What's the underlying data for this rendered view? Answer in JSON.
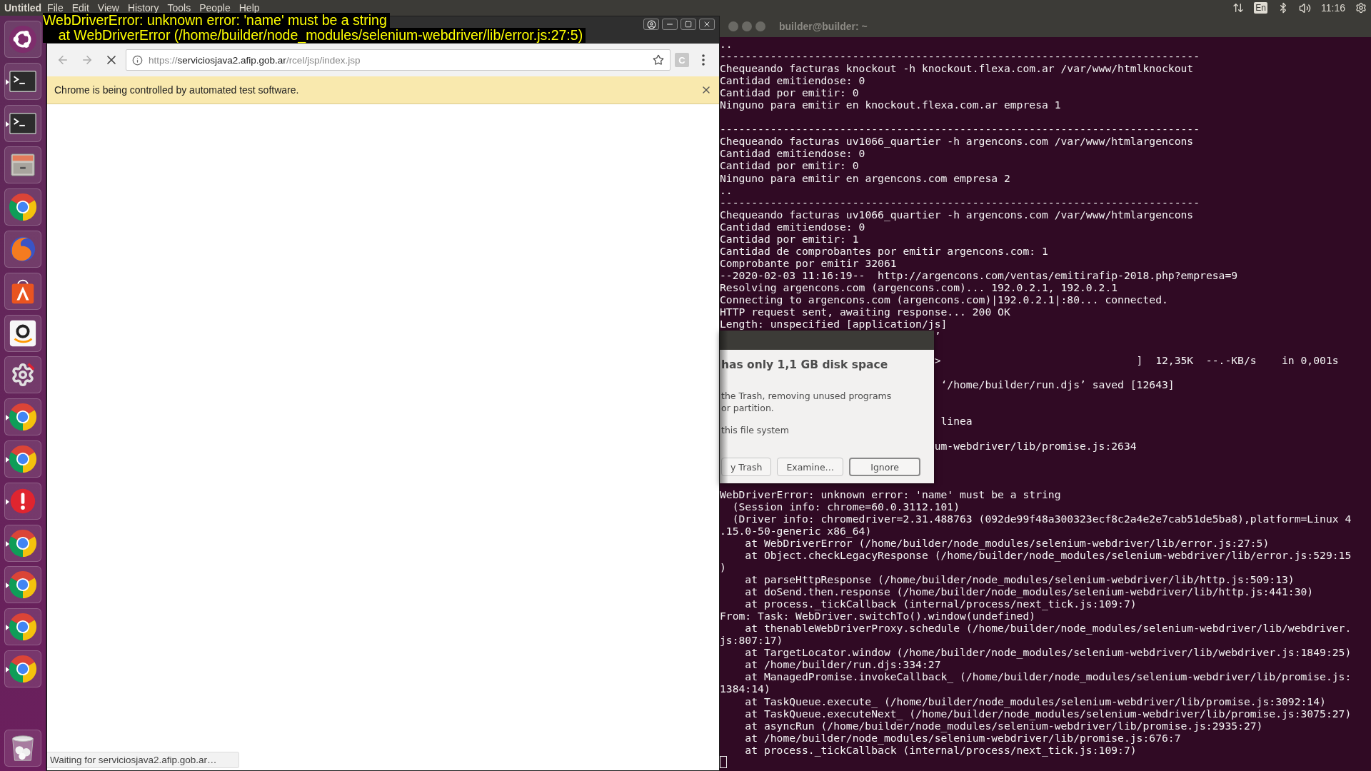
{
  "top_panel": {
    "app_title": "Untitled",
    "menu": [
      "File",
      "Edit",
      "View",
      "History",
      "Tools",
      "People",
      "Help"
    ],
    "keyboard_layout": "En",
    "clock": "11:16"
  },
  "error_overlay": {
    "lines": [
      "WebDriverError: unknown error: 'name' must be a string",
      "    at WebDriverError (/home/builder/node_modules/selenium-webdriver/lib/error.js:27:5)"
    ]
  },
  "launcher": [
    {
      "kind": "ubuntu",
      "running": false
    },
    {
      "kind": "terminal",
      "running": true
    },
    {
      "kind": "terminal",
      "running": true
    },
    {
      "kind": "files",
      "running": false
    },
    {
      "kind": "chrome",
      "running": false
    },
    {
      "kind": "firefox",
      "running": false
    },
    {
      "kind": "store",
      "running": false
    },
    {
      "kind": "amazon",
      "running": false
    },
    {
      "kind": "settings",
      "running": false
    },
    {
      "kind": "chrome",
      "running": true
    },
    {
      "kind": "chrome",
      "running": true
    },
    {
      "kind": "update",
      "running": true
    },
    {
      "kind": "chrome",
      "running": true
    },
    {
      "kind": "chrome",
      "running": true
    },
    {
      "kind": "chrome",
      "running": true
    },
    {
      "kind": "chrome",
      "running": true
    },
    {
      "kind": "trash",
      "running": false
    }
  ],
  "browser": {
    "url": {
      "scheme": "https://",
      "host": "serviciosjava2.afip.gob.ar",
      "path": "/rcel/jsp/index.jsp"
    },
    "loading": true,
    "extension_label": "C",
    "infobar": "Chrome is being controlled by automated test software.",
    "status": "Waiting for serviciosjava2.afip.gob.ar…"
  },
  "terminal": {
    "title": "builder@builder: ~",
    "lines": [
      {
        "kind": "text",
        "text": ".."
      },
      {
        "kind": "text",
        "text": "----------------------------------------------------------------------------"
      },
      {
        "kind": "text",
        "text": "Chequeando facturas knockout -h knockout.flexa.com.ar /var/www/htmlknockout"
      },
      {
        "kind": "text",
        "text": "Cantidad emitiendose: 0"
      },
      {
        "kind": "text",
        "text": "Cantidad por emitir: 0"
      },
      {
        "kind": "text",
        "text": "Ninguno para emitir en knockout.flexa.com.ar empresa 1"
      },
      {
        "kind": "blank"
      },
      {
        "kind": "text",
        "text": "----------------------------------------------------------------------------"
      },
      {
        "kind": "text",
        "text": "Chequeando facturas uv1066_quartier -h argencons.com /var/www/htmlargencons"
      },
      {
        "kind": "text",
        "text": "Cantidad emitiendose: 0"
      },
      {
        "kind": "text",
        "text": "Cantidad por emitir: 0"
      },
      {
        "kind": "text",
        "text": "Ninguno para emitir en argencons.com empresa 2"
      },
      {
        "kind": "text",
        "text": ".."
      },
      {
        "kind": "text",
        "text": "----------------------------------------------------------------------------"
      },
      {
        "kind": "text",
        "text": "Chequeando facturas uv1066_quartier -h argencons.com /var/www/htmlargencons"
      },
      {
        "kind": "text",
        "text": "Cantidad emitiendose: 0"
      },
      {
        "kind": "text",
        "text": "Cantidad por emitir: 1"
      },
      {
        "kind": "text",
        "text": "Cantidad de comprobantes por emitir argencons.com: 1"
      },
      {
        "kind": "text",
        "text": "Comprobante por emitir 32061"
      },
      {
        "kind": "text",
        "text": "--2020-02-03 11:16:19--  http://argencons.com/ventas/emitirafip-2018.php?empresa=9"
      },
      {
        "kind": "text",
        "text": "Resolving argencons.com (argencons.com)... 192.0.2.1, 192.0.2.1"
      },
      {
        "kind": "text",
        "text": "Connecting to argencons.com (argencons.com)|192.0.2.1|:80... connected."
      },
      {
        "kind": "text",
        "text": "HTTP request sent, awaiting response... 200 OK"
      },
      {
        "kind": "text",
        "text": "Length: unspecified [application/js]"
      },
      {
        "kind": "text",
        "text": "                                  ’"
      },
      {
        "kind": "blank"
      },
      {
        "kind": "text",
        "text": "                                  >                               ]  12,35K  --.-KB/s    in 0,001s"
      },
      {
        "kind": "blank"
      },
      {
        "kind": "text",
        "text": "                                   ‘/home/builder/run.djs’ saved [12643]"
      },
      {
        "kind": "blank"
      },
      {
        "kind": "blank"
      },
      {
        "kind": "text",
        "text": "                                   linea"
      },
      {
        "kind": "blank"
      },
      {
        "kind": "text",
        "text": "                                  um-webdriver/lib/promise.js:2634"
      },
      {
        "kind": "blank"
      },
      {
        "kind": "blank"
      },
      {
        "kind": "blank"
      },
      {
        "kind": "text",
        "text": "WebDriverError: unknown error: 'name' must be a string"
      },
      {
        "kind": "text",
        "text": "  (Session info: chrome=60.0.3112.101)"
      },
      {
        "kind": "text",
        "text": "  (Driver info: chromedriver=2.31.488763 (092de99f48a300323ecf8c2a4e2e7cab51de5ba8),platform=Linux 4"
      },
      {
        "kind": "text",
        "text": ".15.0-50-generic x86_64)"
      },
      {
        "kind": "text",
        "text": "    at WebDriverError (/home/builder/node_modules/selenium-webdriver/lib/error.js:27:5)"
      },
      {
        "kind": "text",
        "text": "    at Object.checkLegacyResponse (/home/builder/node_modules/selenium-webdriver/lib/error.js:529:15"
      },
      {
        "kind": "text",
        "text": ")"
      },
      {
        "kind": "text",
        "text": "    at parseHttpResponse (/home/builder/node_modules/selenium-webdriver/lib/http.js:509:13)"
      },
      {
        "kind": "text",
        "text": "    at doSend.then.response (/home/builder/node_modules/selenium-webdriver/lib/http.js:441:30)"
      },
      {
        "kind": "text",
        "text": "    at process._tickCallback (internal/process/next_tick.js:109:7)"
      },
      {
        "kind": "text",
        "text": "From: Task: WebDriver.switchTo().window(undefined)"
      },
      {
        "kind": "text",
        "text": "    at thenableWebDriverProxy.schedule (/home/builder/node_modules/selenium-webdriver/lib/webdriver."
      },
      {
        "kind": "text",
        "text": "js:807:17)"
      },
      {
        "kind": "text",
        "text": "    at TargetLocator.window (/home/builder/node_modules/selenium-webdriver/lib/webdriver.js:1849:25)"
      },
      {
        "kind": "text",
        "text": "    at /home/builder/run.djs:334:27"
      },
      {
        "kind": "text",
        "text": "    at ManagedPromise.invokeCallback_ (/home/builder/node_modules/selenium-webdriver/lib/promise.js:"
      },
      {
        "kind": "text",
        "text": "1384:14)"
      },
      {
        "kind": "text",
        "text": "    at TaskQueue.execute_ (/home/builder/node_modules/selenium-webdriver/lib/promise.js:3092:14)"
      },
      {
        "kind": "text",
        "text": "    at TaskQueue.executeNext_ (/home/builder/node_modules/selenium-webdriver/lib/promise.js:3075:27)"
      },
      {
        "kind": "text",
        "text": "    at asyncRun (/home/builder/node_modules/selenium-webdriver/lib/promise.js:2935:27)"
      },
      {
        "kind": "text",
        "text": "    at /home/builder/node_modules/selenium-webdriver/lib/promise.js:676:7"
      },
      {
        "kind": "text",
        "text": "    at process._tickCallback (internal/process/next_tick.js:109:7)"
      },
      {
        "kind": "cursor"
      }
    ],
    "dialog": {
      "title": "has only 1,1 GB disk space",
      "body": [
        "the Trash, removing unused programs",
        "or partition."
      ],
      "note": "this file system",
      "buttons": [
        {
          "label": "y Trash",
          "default": false
        },
        {
          "label": "Examine…",
          "default": false
        },
        {
          "label": "Ignore",
          "default": true
        }
      ]
    }
  }
}
